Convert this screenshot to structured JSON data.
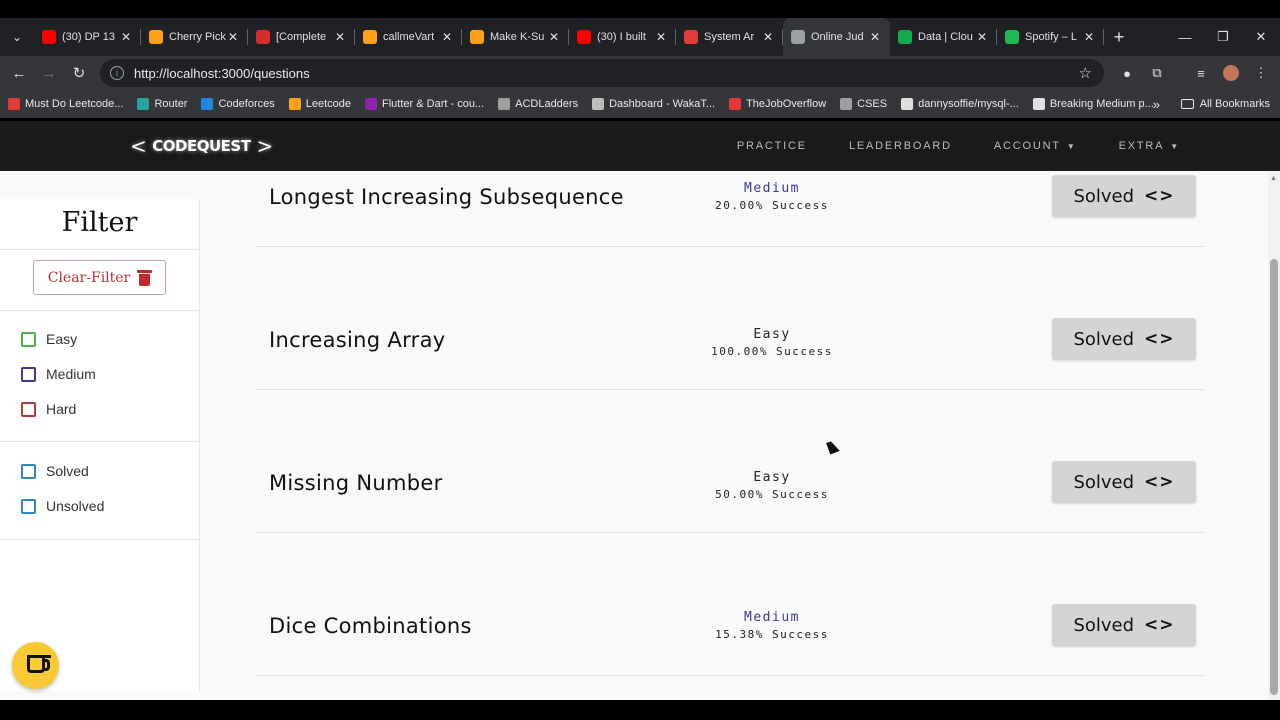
{
  "browser": {
    "tabs": [
      {
        "title": "(30) DP 13",
        "icon": "youtube-icon",
        "color": "#ff0000"
      },
      {
        "title": "Cherry Pick",
        "icon": "leetcode-icon",
        "color": "#ffa116"
      },
      {
        "title": "[Complete",
        "icon": "tuf-icon",
        "color": "#d32f2f"
      },
      {
        "title": "callmeVart",
        "icon": "leetcode-icon",
        "color": "#ffa116"
      },
      {
        "title": "Make K-Su",
        "icon": "leetcode-icon",
        "color": "#ffa116"
      },
      {
        "title": "(30) I built",
        "icon": "youtube-icon",
        "color": "#ff0000"
      },
      {
        "title": "System Ar",
        "icon": "system-icon",
        "color": "#e53935"
      },
      {
        "title": "Online Jud",
        "icon": "code-icon",
        "color": "#9aa0a6"
      },
      {
        "title": "Data | Clou",
        "icon": "mongodb-icon",
        "color": "#13aa52"
      },
      {
        "title": "Spotify – L",
        "icon": "spotify-icon",
        "color": "#1db954"
      }
    ],
    "url": "http://localhost:3000/questions",
    "bookmarks": [
      {
        "label": "Must Do Leetcode...",
        "color": "#e53935"
      },
      {
        "label": "Router",
        "color": "#26a69a"
      },
      {
        "label": "Codeforces",
        "color": "#1e88e5"
      },
      {
        "label": "Leetcode",
        "color": "#ffa116"
      },
      {
        "label": "Flutter & Dart - cou...",
        "color": "#8e24aa"
      },
      {
        "label": "ACDLadders",
        "color": "#9e9e9e"
      },
      {
        "label": "Dashboard - WakaT...",
        "color": "#bdbdbd"
      },
      {
        "label": "TheJobOverflow",
        "color": "#e53935"
      },
      {
        "label": "CSES",
        "color": "#9e9e9e"
      },
      {
        "label": "dannysoffie/mysql-...",
        "color": "#e0e0e0"
      },
      {
        "label": "Breaking Medium p...",
        "color": "#e0e0e0"
      }
    ],
    "all_bookmarks": "All Bookmarks"
  },
  "navbar": {
    "brand": "CODEQUEST",
    "links": [
      "PRACTICE",
      "LEADERBOARD",
      "ACCOUNT",
      "EXTRA"
    ]
  },
  "sidebar": {
    "title": "Filter",
    "clear_label": "Clear-Filter",
    "difficulty_options": [
      {
        "label": "Easy",
        "color": "#4caf50"
      },
      {
        "label": "Medium",
        "color": "#3f3a8c"
      },
      {
        "label": "Hard",
        "color": "#b23a3a"
      }
    ],
    "status_options": [
      {
        "label": "Solved",
        "color": "#2e86c1"
      },
      {
        "label": "Unsolved",
        "color": "#2e86c1"
      }
    ]
  },
  "questions": [
    {
      "title": "Longest Increasing Subsequence",
      "difficulty": "Medium",
      "success": "20.00% Success",
      "status": "Solved"
    },
    {
      "title": "Increasing Array",
      "difficulty": "Easy",
      "success": "100.00% Success",
      "status": "Solved"
    },
    {
      "title": "Missing Number",
      "difficulty": "Easy",
      "success": "50.00% Success",
      "status": "Solved"
    },
    {
      "title": "Dice Combinations",
      "difficulty": "Medium",
      "success": "15.38% Success",
      "status": "Solved"
    }
  ],
  "colors": {
    "medium": "#3f3a8c",
    "easy": "#222222"
  }
}
